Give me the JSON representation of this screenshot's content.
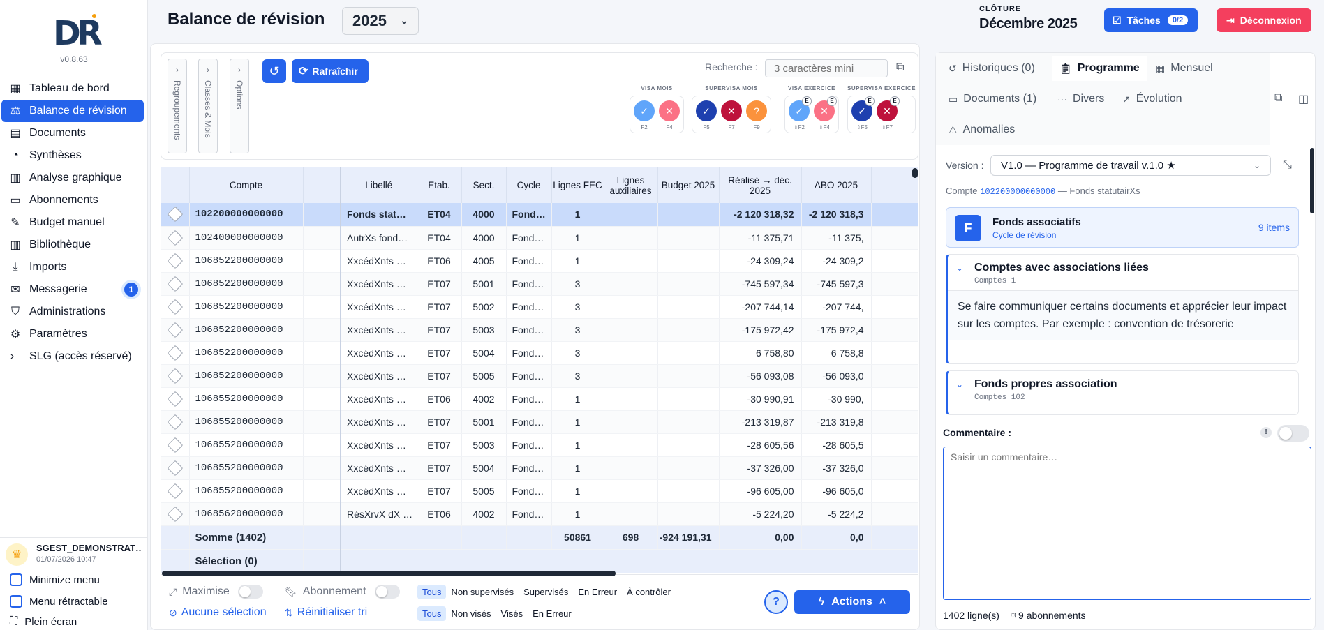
{
  "app": {
    "version": "v0.8.63",
    "page_title": "Balance de révision",
    "year": "2025",
    "cloture_label": "CLÔTURE",
    "cloture_value": "Décembre 2025",
    "taches_label": "Tâches",
    "taches_count": "0/2",
    "deconnexion_label": "Déconnexion",
    "colors": {
      "primary": "#2563eb",
      "danger": "#f43f5e"
    }
  },
  "sidebar": {
    "items": [
      {
        "label": "Tableau de bord",
        "icon": "dashboard-icon"
      },
      {
        "label": "Balance de révision",
        "icon": "scale-icon",
        "active": true
      },
      {
        "label": "Documents",
        "icon": "document-icon"
      },
      {
        "label": "Synthèses",
        "icon": "pie-chart-icon"
      },
      {
        "label": "Analyse graphique",
        "icon": "bar-chart-icon"
      },
      {
        "label": "Abonnements",
        "icon": "card-icon"
      },
      {
        "label": "Budget manuel",
        "icon": "pencil-icon"
      },
      {
        "label": "Bibliothèque",
        "icon": "library-icon"
      },
      {
        "label": "Imports",
        "icon": "download-icon"
      },
      {
        "label": "Messagerie",
        "icon": "mail-icon",
        "badge": "1"
      },
      {
        "label": "Administrations",
        "icon": "shield-icon"
      },
      {
        "label": "Paramètres",
        "icon": "gear-icon"
      },
      {
        "label": "SLG (accès réservé)",
        "icon": "terminal-icon"
      }
    ],
    "user_name": "SGEST_DEMONSTRAT…",
    "user_date": "01/07/2026 10:47",
    "minimize_label": "Minimize menu",
    "retract_label": "Menu rétractable",
    "fullscreen_label": "Plein écran"
  },
  "toolbar": {
    "vtabs": [
      "Regroupements",
      "Classes & Mois",
      "Options"
    ],
    "refresh_label": "Rafraîchir",
    "search_label": "Recherche :",
    "search_placeholder": "3 caractères mini",
    "groups": [
      {
        "label": "VISA MOIS",
        "buttons": [
          {
            "key": "F2",
            "color": "#60a5fa",
            "glyph": "✓"
          },
          {
            "key": "F4",
            "color": "#fb7185",
            "glyph": "✕"
          }
        ]
      },
      {
        "label": "SUPERVISA MOIS",
        "buttons": [
          {
            "key": "F5",
            "color": "#1e40af",
            "glyph": "✓"
          },
          {
            "key": "F7",
            "color": "#be123c",
            "glyph": "✕"
          },
          {
            "key": "F9",
            "color": "#fb923c",
            "glyph": "?"
          }
        ]
      },
      {
        "label": "VISA EXERCICE",
        "buttons": [
          {
            "key": "⇧F2",
            "color": "#60a5fa",
            "glyph": "✓",
            "e": "E"
          },
          {
            "key": "⇧F4",
            "color": "#fb7185",
            "glyph": "✕",
            "e": "E"
          }
        ]
      },
      {
        "label": "SUPERVISA EXERCICE",
        "buttons": [
          {
            "key": "⇧F5",
            "color": "#1e40af",
            "glyph": "✓",
            "e": "E"
          },
          {
            "key": "⇧F7",
            "color": "#be123c",
            "glyph": "✕",
            "e": "E"
          }
        ]
      }
    ]
  },
  "table": {
    "headers": {
      "compte": "Compte",
      "libelle": "Libellé",
      "etab": "Etab.",
      "sect": "Sect.",
      "cycle": "Cycle",
      "lignes_fec": "Lignes FEC",
      "lignes_aux": "Lignes auxiliaires",
      "budget": "Budget 2025",
      "realise": "Réalisé → déc. 2025",
      "abo": "ABO 2025"
    },
    "rows": [
      {
        "compte": "102200000000000",
        "libelle": "Fonds stat…",
        "etab": "ET04",
        "sect": "4000",
        "cycle": "Fond…",
        "fec": "1",
        "aux": "",
        "budget": "",
        "realise": "-2 120 318,32",
        "abo": "-2 120 318,3"
      },
      {
        "compte": "102400000000000",
        "libelle": "AutrXs fond…",
        "etab": "ET04",
        "sect": "4000",
        "cycle": "Fond…",
        "fec": "1",
        "aux": "",
        "budget": "",
        "realise": "-11 375,71",
        "abo": "-11 375,"
      },
      {
        "compte": "106852200000000",
        "libelle": "XxcédXnts …",
        "etab": "ET06",
        "sect": "4005",
        "cycle": "Fond…",
        "fec": "1",
        "aux": "",
        "budget": "",
        "realise": "-24 309,24",
        "abo": "-24 309,2"
      },
      {
        "compte": "106852200000000",
        "libelle": "XxcédXnts …",
        "etab": "ET07",
        "sect": "5001",
        "cycle": "Fond…",
        "fec": "3",
        "aux": "",
        "budget": "",
        "realise": "-745 597,34",
        "abo": "-745 597,3"
      },
      {
        "compte": "106852200000000",
        "libelle": "XxcédXnts …",
        "etab": "ET07",
        "sect": "5002",
        "cycle": "Fond…",
        "fec": "3",
        "aux": "",
        "budget": "",
        "realise": "-207 744,14",
        "abo": "-207 744,"
      },
      {
        "compte": "106852200000000",
        "libelle": "XxcédXnts …",
        "etab": "ET07",
        "sect": "5003",
        "cycle": "Fond…",
        "fec": "3",
        "aux": "",
        "budget": "",
        "realise": "-175 972,42",
        "abo": "-175 972,4"
      },
      {
        "compte": "106852200000000",
        "libelle": "XxcédXnts …",
        "etab": "ET07",
        "sect": "5004",
        "cycle": "Fond…",
        "fec": "3",
        "aux": "",
        "budget": "",
        "realise": "6 758,80",
        "abo": "6 758,8"
      },
      {
        "compte": "106852200000000",
        "libelle": "XxcédXnts …",
        "etab": "ET07",
        "sect": "5005",
        "cycle": "Fond…",
        "fec": "3",
        "aux": "",
        "budget": "",
        "realise": "-56 093,08",
        "abo": "-56 093,0"
      },
      {
        "compte": "106855200000000",
        "libelle": "XxcédXnts …",
        "etab": "ET06",
        "sect": "4002",
        "cycle": "Fond…",
        "fec": "1",
        "aux": "",
        "budget": "",
        "realise": "-30 990,91",
        "abo": "-30 990,"
      },
      {
        "compte": "106855200000000",
        "libelle": "XxcédXnts …",
        "etab": "ET07",
        "sect": "5001",
        "cycle": "Fond…",
        "fec": "1",
        "aux": "",
        "budget": "",
        "realise": "-213 319,87",
        "abo": "-213 319,8"
      },
      {
        "compte": "106855200000000",
        "libelle": "XxcédXnts …",
        "etab": "ET07",
        "sect": "5003",
        "cycle": "Fond…",
        "fec": "1",
        "aux": "",
        "budget": "",
        "realise": "-28 605,56",
        "abo": "-28 605,5"
      },
      {
        "compte": "106855200000000",
        "libelle": "XxcédXnts …",
        "etab": "ET07",
        "sect": "5004",
        "cycle": "Fond…",
        "fec": "1",
        "aux": "",
        "budget": "",
        "realise": "-37 326,00",
        "abo": "-37 326,0"
      },
      {
        "compte": "106855200000000",
        "libelle": "XxcédXnts …",
        "etab": "ET07",
        "sect": "5005",
        "cycle": "Fond…",
        "fec": "1",
        "aux": "",
        "budget": "",
        "realise": "-96 605,00",
        "abo": "-96 605,0"
      },
      {
        "compte": "106856200000000",
        "libelle": "RésXrvX dX …",
        "etab": "ET06",
        "sect": "4002",
        "cycle": "Fond…",
        "fec": "1",
        "aux": "",
        "budget": "",
        "realise": "-5 224,20",
        "abo": "-5 224,2"
      }
    ],
    "footer": {
      "somme_label": "Somme (1402)",
      "fec": "50861",
      "aux": "698",
      "budget": "-924 191,31",
      "realise": "0,00",
      "abo": "0,0",
      "selection_label": "Sélection (0)"
    }
  },
  "bottom": {
    "maximise": "Maximise",
    "abonnement": "Abonnement",
    "aucune_selection": "Aucune sélection",
    "reinit_tri": "Réinitialiser tri",
    "filters_super": [
      "Tous",
      "Non supervisés",
      "Supervisés",
      "En Erreur",
      "À contrôler"
    ],
    "filters_visa": [
      "Tous",
      "Non visés",
      "Visés",
      "En Erreur"
    ],
    "actions_label": "Actions"
  },
  "right": {
    "tabs": [
      {
        "label": "Historiques (0)",
        "icon": "history-icon"
      },
      {
        "label": "Programme",
        "icon": "clipboard-icon",
        "active": true
      },
      {
        "label": "Mensuel",
        "icon": "calendar-icon"
      },
      {
        "label": "Documents (1)",
        "icon": "folder-icon"
      },
      {
        "label": "Divers",
        "icon": "dots-icon"
      },
      {
        "label": "Évolution",
        "icon": "trend-icon"
      },
      {
        "label": "Anomalies",
        "icon": "warning-icon"
      }
    ],
    "version_label": "Version :",
    "version_value": "V1.0 — Programme de travail v.1.0 ★",
    "compte_prefix": "Compte",
    "compte_code": "102200000000000",
    "compte_name": "— Fonds statutairXs",
    "cycle_letter": "F",
    "cycle_title": "Fonds associatifs",
    "cycle_sub": "Cycle de révision",
    "cycle_items": "9 items",
    "programmes": [
      {
        "title": "Comptes avec associations liées",
        "sub": "Comptes 1",
        "body": "Se faire communiquer certains documents et apprécier leur impact sur les comptes. Par exemple : convention de trésorerie"
      },
      {
        "title": "Fonds propres association",
        "sub": "Comptes 102",
        "body": ""
      }
    ],
    "comment_label": "Commentaire :",
    "comment_placeholder": "Saisir un commentaire…",
    "lines_count": "1402 ligne(s)",
    "abonnements_count": "9 abonnements"
  }
}
